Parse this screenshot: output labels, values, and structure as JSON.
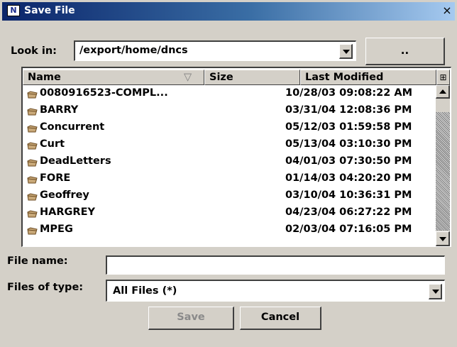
{
  "window": {
    "title": "Save File",
    "app_icon_glyph": "N",
    "close_glyph": "×"
  },
  "look_in": {
    "label": "Look in:",
    "value": "/export/home/dncs",
    "up_button_label": ".."
  },
  "file_list": {
    "columns": [
      "Name",
      "Size",
      "Last Modified"
    ],
    "sort_indicator": "▽",
    "rows": [
      {
        "name": "0080916523-COMPL...",
        "size": "",
        "modified": "10/28/03 09:08:22 AM"
      },
      {
        "name": "BARRY",
        "size": "",
        "modified": "03/31/04 12:08:36 PM"
      },
      {
        "name": "Concurrent",
        "size": "",
        "modified": "05/12/03 01:59:58 PM"
      },
      {
        "name": "Curt",
        "size": "",
        "modified": "05/13/04 03:10:30 PM"
      },
      {
        "name": "DeadLetters",
        "size": "",
        "modified": "04/01/03 07:30:50 PM"
      },
      {
        "name": "FORE",
        "size": "",
        "modified": "01/14/03 04:20:20 PM"
      },
      {
        "name": "Geoffrey",
        "size": "",
        "modified": "03/10/04 10:36:31 PM"
      },
      {
        "name": "HARGREY",
        "size": "",
        "modified": "04/23/04 06:27:22 PM"
      },
      {
        "name": "MPEG",
        "size": "",
        "modified": "02/03/04 07:16:05 PM"
      }
    ]
  },
  "file_name": {
    "label": "File name:",
    "value": ""
  },
  "file_type": {
    "label": "Files of type:",
    "value": "All Files (*)"
  },
  "buttons": {
    "save": "Save",
    "cancel": "Cancel"
  },
  "colors": {
    "title_start": "#0a246a",
    "title_end": "#a6caf0",
    "face": "#d4d0c8",
    "folder": "#c8a878"
  }
}
